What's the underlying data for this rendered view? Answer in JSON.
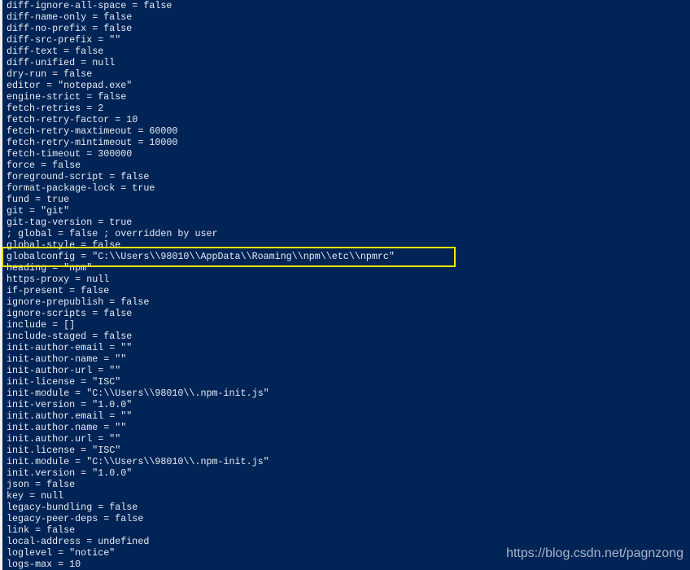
{
  "terminal": {
    "lines": [
      "diff-ignore-all-space = false",
      "diff-name-only = false",
      "diff-no-prefix = false",
      "diff-src-prefix = ″″",
      "diff-text = false",
      "diff-unified = null",
      "dry-run = false",
      "editor = ″notepad.exe″",
      "engine-strict = false",
      "fetch-retries = 2",
      "fetch-retry-factor = 10",
      "fetch-retry-maxtimeout = 60000",
      "fetch-retry-mintimeout = 10000",
      "fetch-timeout = 300000",
      "force = false",
      "foreground-script = false",
      "format-package-lock = true",
      "fund = true",
      "git = ″git″",
      "git-tag-version = true",
      "; global = false ; overridden by user",
      "global-style = false",
      "globalconfig = ″C:\\\\Users\\\\98010\\\\AppData\\\\Roaming\\\\npm\\\\etc\\\\npmrc″",
      "heading = ″npm″",
      "https-proxy = null",
      "if-present = false",
      "ignore-prepublish = false",
      "ignore-scripts = false",
      "include = []",
      "include-staged = false",
      "init-author-email = ″″",
      "init-author-name = ″″",
      "init-author-url = ″″",
      "init-license = ″ISC″",
      "init-module = ″C:\\\\Users\\\\98010\\\\.npm-init.js″",
      "init-version = ″1.0.0″",
      "init.author.email = ″″",
      "init.author.name = ″″",
      "init.author.url = ″″",
      "init.license = ″ISC″",
      "init.module = ″C:\\\\Users\\\\98010\\\\.npm-init.js″",
      "init.version = ″1.0.0″",
      "json = false",
      "key = null",
      "legacy-bundling = false",
      "legacy-peer-deps = false",
      "link = false",
      "local-address = undefined",
      "loglevel = ″notice″",
      "logs-max = 10"
    ]
  },
  "watermark": "https://blog.csdn.net/pagnzong",
  "colors": {
    "background": "#012456",
    "text": "#e8ecf4",
    "highlight": "#f2e600"
  }
}
